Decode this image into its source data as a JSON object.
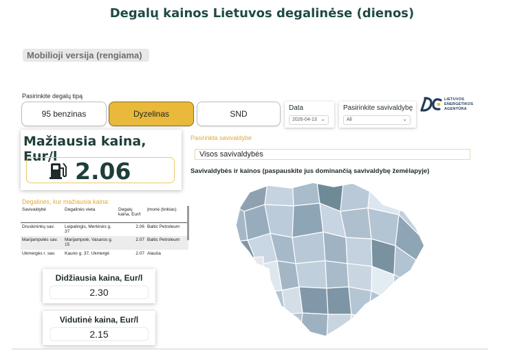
{
  "header": {
    "title": "Degalų kainos Lietuvos degalinėse (dienos)"
  },
  "mobile_badge": "Mobilioji versija (rengiama)",
  "fuel": {
    "label": "Pasirinkite degalų tipą",
    "options": [
      "95 benzinas",
      "Dyzelinas",
      "SND"
    ],
    "selected": "Dyzelinas"
  },
  "filters": {
    "date_label": "Data",
    "date_value": "2026-04-13",
    "municipality_label": "Pasirinkite savivaldybę",
    "municipality_value": "All"
  },
  "logo": {
    "line1": "LIETUVOS",
    "line2": "ENERGETIKOS",
    "line3": "AGENTŪRA"
  },
  "min_price": {
    "title": "Mažiausia kaina, Eur/l",
    "value": "2.06"
  },
  "cheapest": {
    "label": "Degalinės, kur mažiausia kaina:",
    "columns": [
      "Savivaldybė",
      "Degalinės vieta",
      "Degalų kaina, Eur/l",
      "Įmonė (tinklas)"
    ],
    "rows": [
      [
        "Druskininkų sav.",
        "Leipalingis, Merkinės g. 37",
        "2.06",
        "Baltic Petroleum"
      ],
      [
        "Marijampolės sav.",
        "Marijampolė, Vasaros g. 15",
        "2.07",
        "Baltic Petroleum"
      ],
      [
        "Ukmergės r. sav.",
        "Kauno g. 37, Ukmergė",
        "2.07",
        "Alauša"
      ]
    ]
  },
  "max_price": {
    "title": "Didžiausia kaina, Eur/l",
    "value": "2.30"
  },
  "avg_price": {
    "title": "Vidutinė kaina, Eur/l",
    "value": "2.15"
  },
  "selected_municipality": {
    "label": "Pasirinkta savivaldybė",
    "value": "Visos savivaldybės"
  },
  "map": {
    "label": "Savivaldybės ir kainos (paspauskite jus dominančią savivaldybę žemėlapyje)"
  },
  "colors": {
    "accent": "#e8b93b",
    "title": "#1e4a44",
    "orange_label": "#e1a93a"
  }
}
